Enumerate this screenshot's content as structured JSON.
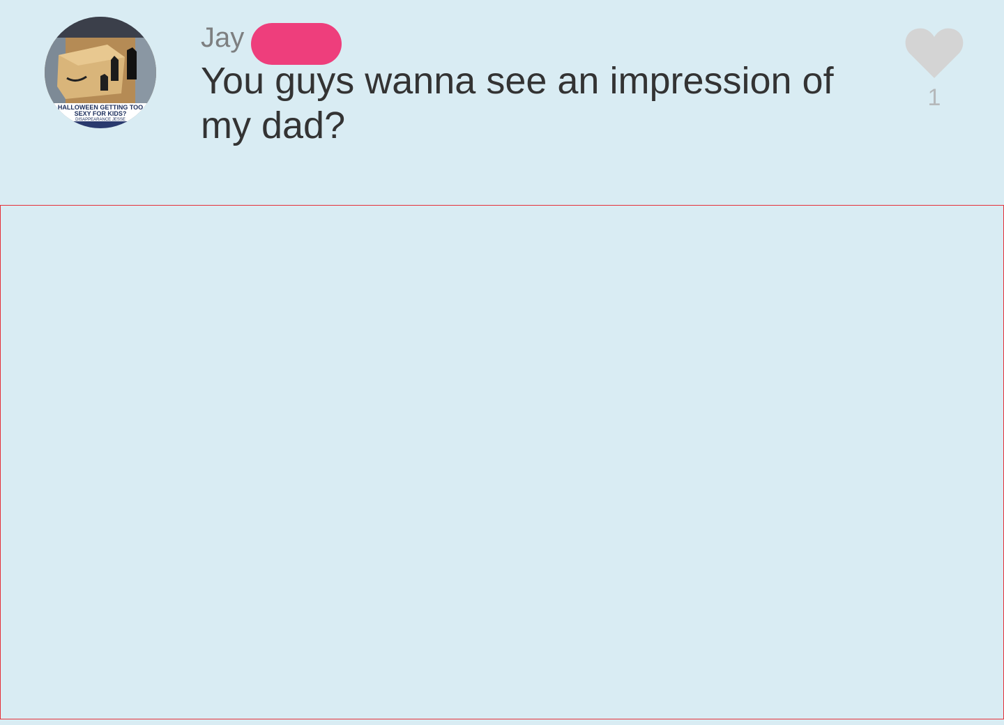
{
  "comment": {
    "author": "Jay",
    "text": "You guys wanna see an impression of my dad?",
    "like_count": "1",
    "avatar_caption": [
      "HALLOWEEN GETTING TOO",
      "SEXY FOR KIDS?",
      "DISAPPEARANCE JESSE"
    ]
  },
  "colors": {
    "background": "#d9ecf3",
    "redaction": "#ee3e7c",
    "frame_border": "#e53038",
    "heart": "#d4d4d4"
  },
  "icons": {
    "like": "heart-icon",
    "avatar": "user-avatar-photo"
  }
}
